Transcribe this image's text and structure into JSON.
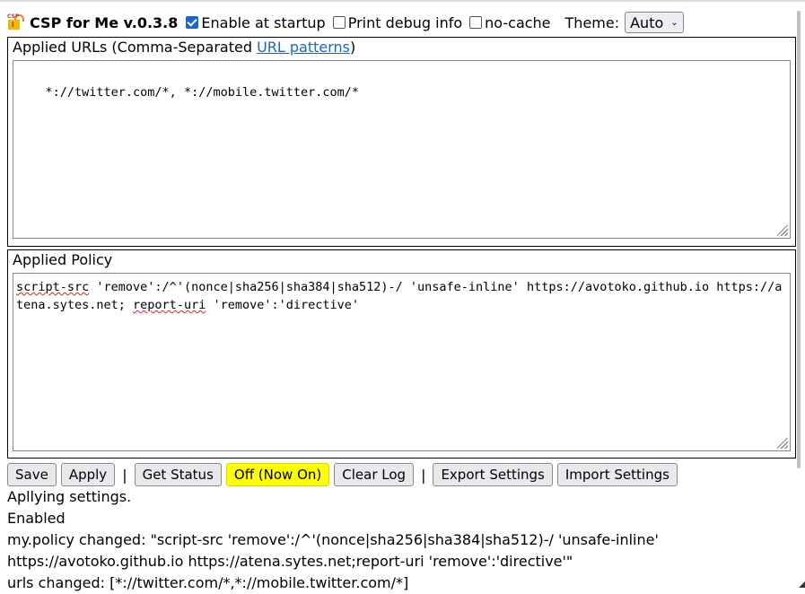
{
  "header": {
    "logo_icon": "csp-lock-icon",
    "title": "CSP for Me",
    "version": "v.0.3.8",
    "options": [
      {
        "label": "Enable at startup",
        "checked": true
      },
      {
        "label": "Print debug info",
        "checked": false
      },
      {
        "label": "no-cache",
        "checked": false
      }
    ],
    "theme_label": "Theme:",
    "theme_value": "Auto"
  },
  "urls_section": {
    "legend_prefix": "Applied URLs (Comma-Separated ",
    "legend_link": "URL patterns",
    "legend_suffix": ")",
    "value": "*://twitter.com/*, *://mobile.twitter.com/*"
  },
  "policy_section": {
    "legend": "Applied Policy",
    "value_parts": {
      "p1": "script-src",
      "p2": " 'remove':/^'(nonce|sha256|sha384|sha512)-/ 'unsafe-inline' https://avotoko.github.io https://atena.sytes.net; ",
      "p3": "report-uri",
      "p4": " 'remove':'directive'"
    }
  },
  "buttons": {
    "save": "Save",
    "apply": "Apply",
    "separator": "|",
    "get_status": "Get Status",
    "toggle": "Off (Now On)",
    "clear_log": "Clear Log",
    "export": "Export Settings",
    "import": "Import Settings"
  },
  "log": [
    "Apllying settings.",
    "Enabled",
    "my.policy changed: \"script-src 'remove':/^'(nonce|sha256|sha384|sha512)-/ 'unsafe-inline' https://avotoko.github.io https://atena.sytes.net;report-uri 'remove':'directive'\"",
    "urls changed: [*://twitter.com/*,*://mobile.twitter.com/*]"
  ],
  "colors": {
    "accent": "#1a66d0",
    "toggle_bg": "#ffff00"
  }
}
